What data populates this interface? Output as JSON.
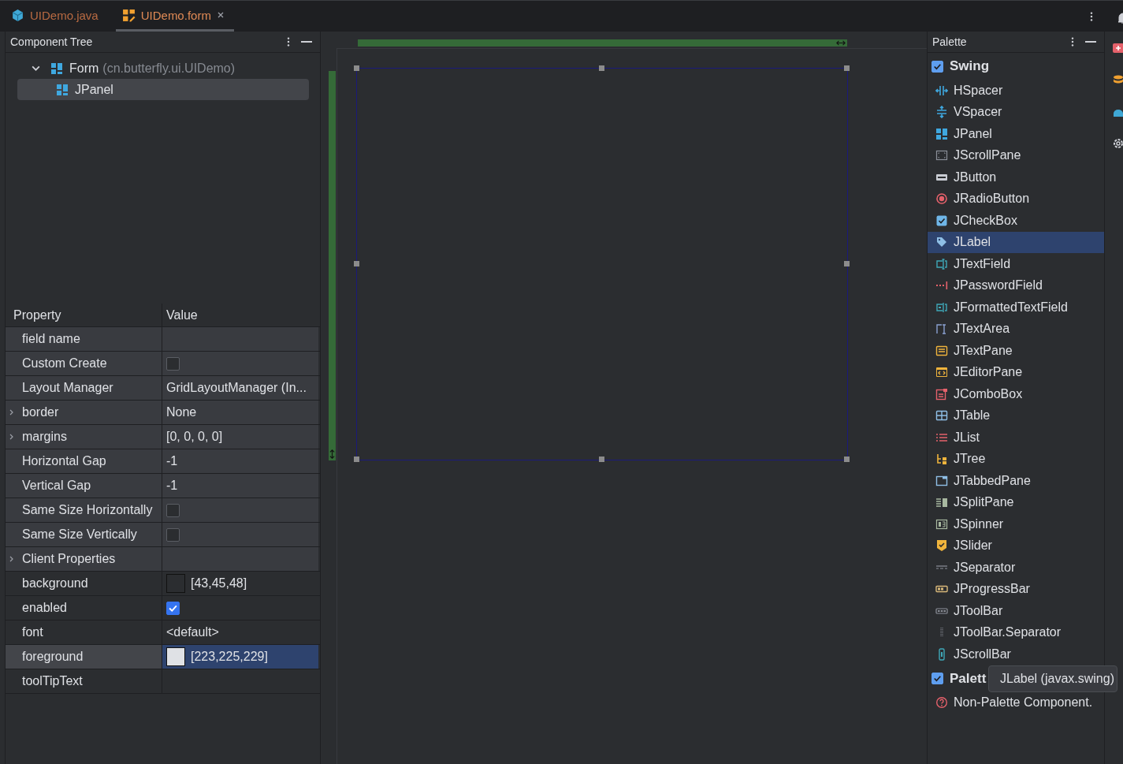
{
  "tabs": [
    {
      "label": "UIDemo.java",
      "kind": "java",
      "selected": false,
      "closable": false
    },
    {
      "label": "UIDemo.form",
      "kind": "form",
      "selected": true,
      "closable": true
    }
  ],
  "component_tree": {
    "title": "Component Tree",
    "nodes": [
      {
        "label": "Form",
        "detail": "(cn.butterfly.ui.UIDemo)",
        "expanded": true,
        "selected": false,
        "children": [
          {
            "label": "JPanel",
            "selected": true
          }
        ]
      }
    ]
  },
  "properties": {
    "columns": [
      "Property",
      "Value"
    ],
    "sections": [
      {
        "rows": [
          {
            "name": "field name",
            "kind": "text",
            "expandable": false,
            "selected": false
          },
          {
            "name": "Custom Create",
            "kind": "checkbox",
            "checked": false,
            "expandable": false,
            "selected": false
          },
          {
            "name": "Layout Manager",
            "kind": "text",
            "value": "GridLayoutManager (In...",
            "expandable": false,
            "selected": false
          },
          {
            "name": "border",
            "kind": "text",
            "value": "None",
            "expandable": true,
            "selected": false
          },
          {
            "name": "margins",
            "kind": "text",
            "value": "[0, 0, 0, 0]",
            "expandable": true,
            "selected": false
          },
          {
            "name": "Horizontal Gap",
            "kind": "text",
            "value": "-1",
            "expandable": false,
            "selected": false
          },
          {
            "name": "Vertical Gap",
            "kind": "text",
            "value": "-1",
            "expandable": false,
            "selected": false
          },
          {
            "name": "Same Size Horizontally",
            "kind": "checkbox",
            "checked": false,
            "expandable": false,
            "selected": false
          },
          {
            "name": "Same Size Vertically",
            "kind": "checkbox",
            "checked": false,
            "expandable": false,
            "selected": false
          },
          {
            "name": "Client Properties",
            "kind": "text",
            "expandable": true,
            "selected": false
          }
        ]
      },
      {
        "rows": [
          {
            "name": "background",
            "kind": "color",
            "color": "#2b2d30",
            "value": "[43,45,48]",
            "expandable": false,
            "selected": false
          },
          {
            "name": "enabled",
            "kind": "checkbox",
            "checked": true,
            "expandable": false,
            "selected": false
          },
          {
            "name": "font",
            "kind": "text",
            "value": "<default>",
            "expandable": false,
            "selected": false
          },
          {
            "name": "foreground",
            "kind": "color",
            "color": "#dfe1e5",
            "value": "[223,225,229]",
            "expandable": false,
            "selected": true
          },
          {
            "name": "toolTipText",
            "kind": "text",
            "expandable": false,
            "selected": false
          }
        ]
      }
    ]
  },
  "palette": {
    "title": "Palette",
    "groups": [
      {
        "label": "Swing",
        "checked": true,
        "items": [
          {
            "label": "HSpacer",
            "kind": "hspacer",
            "selected": false
          },
          {
            "label": "VSpacer",
            "kind": "vspacer",
            "selected": false
          },
          {
            "label": "JPanel",
            "kind": "panel",
            "selected": false
          },
          {
            "label": "JScrollPane",
            "kind": "scrollpane",
            "selected": false
          },
          {
            "label": "JButton",
            "kind": "button",
            "selected": false
          },
          {
            "label": "JRadioButton",
            "kind": "radio",
            "selected": false
          },
          {
            "label": "JCheckBox",
            "kind": "checkbox",
            "selected": false
          },
          {
            "label": "JLabel",
            "kind": "label",
            "selected": true
          },
          {
            "label": "JTextField",
            "kind": "textfield",
            "selected": false
          },
          {
            "label": "JPasswordField",
            "kind": "password",
            "selected": false
          },
          {
            "label": "JFormattedTextField",
            "kind": "formatted",
            "selected": false
          },
          {
            "label": "JTextArea",
            "kind": "textarea",
            "selected": false
          },
          {
            "label": "JTextPane",
            "kind": "textpane",
            "selected": false
          },
          {
            "label": "JEditorPane",
            "kind": "editorpane",
            "selected": false
          },
          {
            "label": "JComboBox",
            "kind": "combobox",
            "selected": false
          },
          {
            "label": "JTable",
            "kind": "table",
            "selected": false
          },
          {
            "label": "JList",
            "kind": "list",
            "selected": false
          },
          {
            "label": "JTree",
            "kind": "tree",
            "selected": false
          },
          {
            "label": "JTabbedPane",
            "kind": "tabbedpane",
            "selected": false
          },
          {
            "label": "JSplitPane",
            "kind": "splitpane",
            "selected": false
          },
          {
            "label": "JSpinner",
            "kind": "spinner",
            "selected": false
          },
          {
            "label": "JSlider",
            "kind": "slider",
            "selected": false
          },
          {
            "label": "JSeparator",
            "kind": "separator",
            "selected": false
          },
          {
            "label": "JProgressBar",
            "kind": "progressbar",
            "selected": false
          },
          {
            "label": "JToolBar",
            "kind": "toolbar",
            "selected": false
          },
          {
            "label": "JToolBar.Separator",
            "kind": "toolbarsep",
            "selected": false
          },
          {
            "label": "JScrollBar",
            "kind": "scrollbar",
            "selected": false
          }
        ]
      },
      {
        "label": "Palett",
        "checked": true,
        "items": [
          {
            "label": "Non-Palette Component.",
            "kind": "unknown",
            "selected": false
          }
        ]
      }
    ]
  },
  "tooltip": {
    "text": "JLabel (javax.swing)"
  }
}
